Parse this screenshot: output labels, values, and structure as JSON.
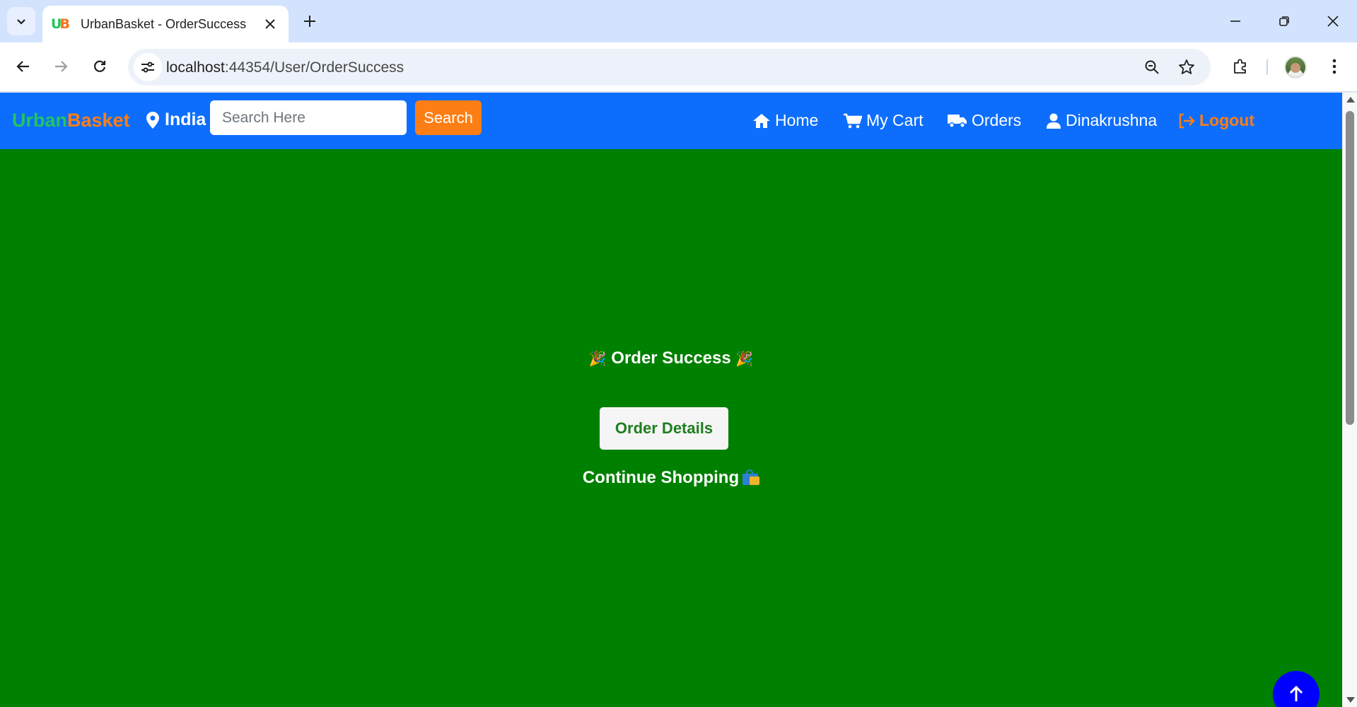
{
  "browser": {
    "tab_title": "UrbanBasket - OrderSuccess",
    "favicon_text": "UB",
    "url_host": "localhost",
    "url_path": ":44354/User/OrderSuccess"
  },
  "navbar": {
    "brand_part1": "Urban",
    "brand_part2": "Basket",
    "location": "India",
    "search_placeholder": "Search Here",
    "search_button": "Search",
    "links": {
      "home": "Home",
      "cart": "My Cart",
      "orders": "Orders",
      "user": "Dinakrushna",
      "logout": "Logout"
    }
  },
  "main": {
    "success_title": "Order Success",
    "title_emoji": "🎉",
    "details_button": "Order Details",
    "continue_link": "Continue Shopping"
  },
  "colors": {
    "page_background": "#008000",
    "navbar": "#0d6efd",
    "accent_orange": "#fd7e14",
    "brand_green": "#22c55e",
    "scroll_top_button": "#0000ff"
  },
  "icons": [
    "tab-search-icon",
    "close-icon",
    "plus-icon",
    "minimize-icon",
    "restore-icon",
    "back-arrow-icon",
    "forward-arrow-icon",
    "reload-icon",
    "site-info-icon",
    "zoom-icon",
    "star-icon",
    "extensions-icon",
    "menu-icon",
    "location-pin-icon",
    "home-icon",
    "cart-icon",
    "truck-icon",
    "user-icon",
    "logout-icon",
    "shopping-bags-icon",
    "arrow-up-icon"
  ]
}
